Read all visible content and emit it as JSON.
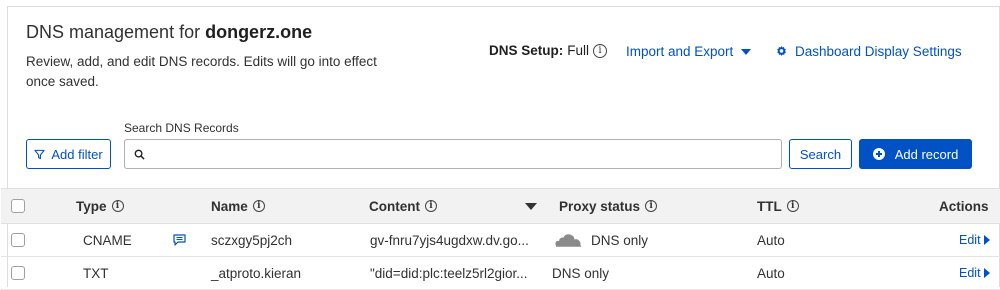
{
  "header": {
    "title_prefix": "DNS management for ",
    "domain": "dongerz.one",
    "subtitle": "Review, add, and edit DNS records. Edits will go into effect once saved."
  },
  "setup": {
    "label": "DNS Setup:",
    "value": "Full",
    "info_icon": "i"
  },
  "links": {
    "import_export": "Import and Export",
    "dashboard_settings": "Dashboard Display Settings"
  },
  "toolbar": {
    "add_filter": "Add filter",
    "search_label": "Search DNS Records",
    "search_placeholder": "",
    "search_button": "Search",
    "add_record": "Add record"
  },
  "table": {
    "columns": {
      "type": "Type",
      "name": "Name",
      "content": "Content",
      "proxy": "Proxy status",
      "ttl": "TTL",
      "actions": "Actions"
    },
    "rows": [
      {
        "type": "CNAME",
        "name": "sczxgy5pj2ch",
        "content": "gv-fnru7yjs4ugdxw.dv.go...",
        "proxy": "DNS only",
        "ttl": "Auto",
        "action": "Edit"
      },
      {
        "type": "TXT",
        "name": "_atproto.kieran",
        "content": "\"did=did:plc:teelz5rl2gior...",
        "proxy": "DNS only",
        "ttl": "Auto",
        "action": "Edit"
      }
    ]
  },
  "colors": {
    "accent": "#0051c3",
    "header_bg": "#f2f2f2",
    "cloud_gray": "#8a8a8a"
  },
  "icons": {
    "filter": "funnel-icon",
    "search": "magnifier-icon",
    "add": "plus-circle-icon",
    "settings": "gear-icon",
    "comment": "comment-icon",
    "proxy": "cloud-icon"
  }
}
